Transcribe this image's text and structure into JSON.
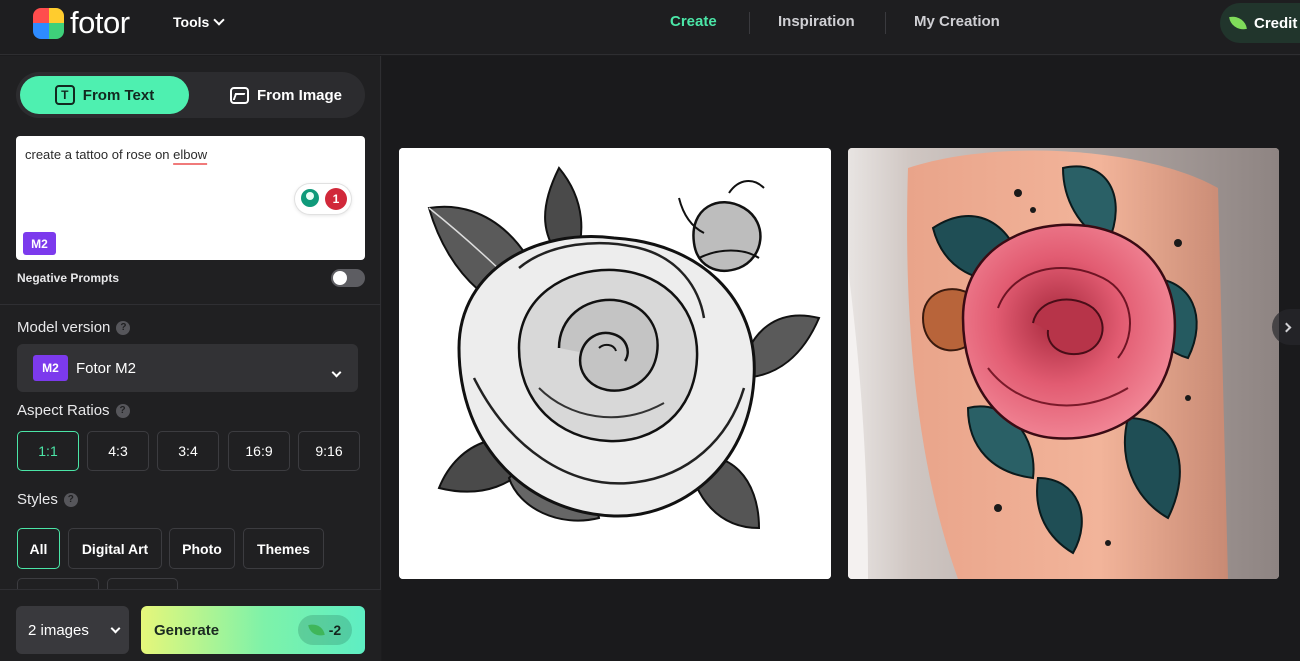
{
  "header": {
    "logo_text": "fotor",
    "tools_label": "Tools",
    "nav": [
      {
        "label": "Create",
        "active": true
      },
      {
        "label": "Inspiration",
        "active": false
      },
      {
        "label": "My Creation",
        "active": false
      }
    ],
    "credits_label": "Credit"
  },
  "mode": {
    "tabs": [
      {
        "label": "From Text",
        "icon": "text-icon",
        "active": true
      },
      {
        "label": "From Image",
        "icon": "image-icon",
        "active": false
      }
    ]
  },
  "prompt": {
    "text_before": "create a tattoo of rose on ",
    "text_flagged": "elbow",
    "issue_count": "1",
    "model_badge": "M2"
  },
  "negative_prompts": {
    "label": "Negative Prompts",
    "enabled": false
  },
  "model": {
    "section_label": "Model version",
    "badge": "M2",
    "selected": "Fotor M2"
  },
  "aspect": {
    "section_label": "Aspect Ratios",
    "options": [
      "1:1",
      "4:3",
      "3:4",
      "16:9",
      "9:16"
    ],
    "selected": "1:1"
  },
  "styles": {
    "section_label": "Styles",
    "options": [
      "All",
      "Digital Art",
      "Photo",
      "Themes"
    ],
    "selected": "All"
  },
  "generate": {
    "count_label": "2 images",
    "button_label": "Generate",
    "cost": "-2"
  },
  "results": [
    {
      "kind": "black-and-white rose tattoo illustration"
    },
    {
      "kind": "color rose tattoo on arm"
    }
  ],
  "colors": {
    "accent": "#4be6a7",
    "badge": "#7c3aed",
    "alert": "#d1283a"
  }
}
